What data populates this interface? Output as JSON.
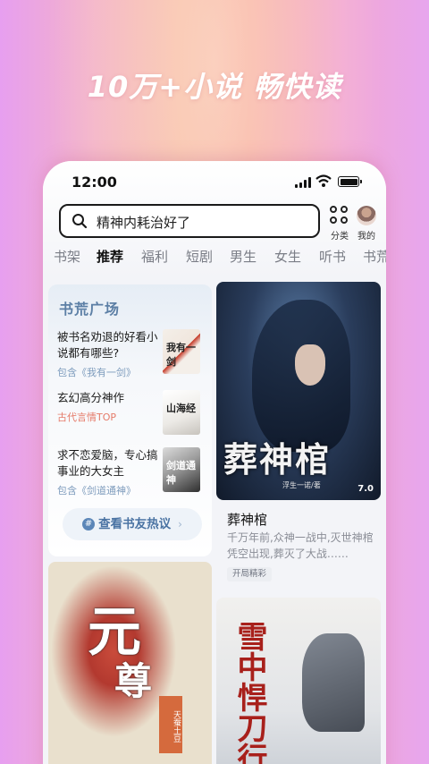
{
  "headline": "10万+小说 畅快读",
  "status_bar": {
    "time": "12:00"
  },
  "search": {
    "text": "精神内耗治好了"
  },
  "top_buttons": {
    "category": "分类",
    "mine": "我的"
  },
  "tabs": [
    "书架",
    "推荐",
    "福利",
    "短剧",
    "男生",
    "女生",
    "听书",
    "书荒"
  ],
  "active_tab": "推荐",
  "square": {
    "title": "书荒广场",
    "items": [
      {
        "title": "被书名劝退的好看小说都有哪些?",
        "sub": "包含《我有一剑》",
        "cover_text": "我有一剑"
      },
      {
        "title": "玄幻高分神作",
        "sub": "古代言情TOP",
        "cover_text": "山海经"
      },
      {
        "title": "求不恋爱脑，专心搞事业的大女主",
        "sub": "包含《剑道通神》",
        "cover_text": "剑道通神"
      }
    ],
    "hot_button": "查看书友热议"
  },
  "featured": {
    "cover_title": "葬神棺",
    "cover_author": "浮生一诺/著",
    "rating": "7.0",
    "name": "葬神棺",
    "desc": "千万年前,众神一战中,灭世神棺凭空出现,葬灭了大战……",
    "tag": "开局精彩"
  },
  "cover_yuan": {
    "title_1": "元",
    "title_2": "尊",
    "tag": "天蚕土豆"
  },
  "cover_xue": {
    "title": "雪中悍刀行"
  },
  "colors": {
    "accent_blue": "#5c7fa5",
    "tag_red": "#e57b6a"
  }
}
